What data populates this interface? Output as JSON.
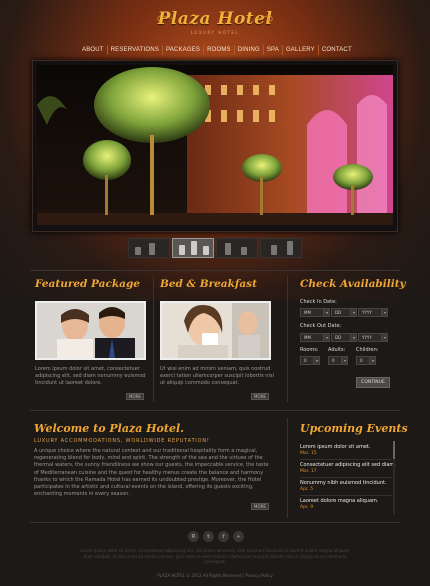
{
  "header": {
    "title": "Plaza Hotel",
    "subtitle": "LUXURY HOTEL"
  },
  "nav": {
    "items": [
      "ABOUT",
      "RESERVATIONS",
      "PACKAGES",
      "ROOMS",
      "DINING",
      "SPA",
      "GALLERY",
      "CONTACT"
    ]
  },
  "featured": {
    "title": "Featured Package",
    "text": "Lorem ipsum dolor sit amet, consectetuer adipiscing elit, sed diam nonummy euismod tincidunt ut laoreet dolore.",
    "more": "MORE"
  },
  "bnb": {
    "title": "Bed & Breakfast",
    "text": "Ut wisi enim ad minim veniam, quis nostrud exerci tation ullamcorper suscipit lobortis nisl ut aliquip commodo consequat.",
    "more": "MORE"
  },
  "availability": {
    "title": "Check Availability",
    "check_in_label": "Check In Date:",
    "check_out_label": "Check Out Date:",
    "check_in": {
      "month": "MM",
      "day": "DD",
      "year": "YYYY"
    },
    "check_out": {
      "month": "MM",
      "day": "DD",
      "year": "YYYY"
    },
    "rooms_label": "Rooms:",
    "adults_label": "Adults:",
    "children_label": "Children:",
    "rooms_value": "0",
    "adults_value": "0",
    "children_value": "0",
    "continue": "CONTINUE"
  },
  "welcome": {
    "title": "Welcome to Plaza Hotel.",
    "subtitle": "LUXURY ACCOMMODATIONS, WORLDWIDE REPUTATION!",
    "text": "A unique choice where the natural context and our traditional hospitality form a magical, regenerating blend for body, mind and spirit. The strength of the sea and the virtues of the thermal waters, the sunny friendliness we show our guests, the impeccable service, the taste of Mediterranean cuisine and the quest for healthy menus create the balance and harmony thanks to which the Ramada Hotel has earned its undoubted prestige. Moreover, the Hotel participates in the artistic and cultural events on the island, offering its guests exciting, enchanting moments in every season.",
    "more": "MORE"
  },
  "events": {
    "title": "Upcoming Events",
    "items": [
      {
        "title": "Lorem ipsum dolor sit amet.",
        "date": "Mar. 15"
      },
      {
        "title": "Consectetuer adipiscing elit sed diam.",
        "date": "Mar. 17"
      },
      {
        "title": "Nonummy nibh euismod tincidunt.",
        "date": "Apr. 5"
      },
      {
        "title": "Laoreet dolore magna aliquam.",
        "date": "Apr. 9"
      }
    ]
  },
  "footer": {
    "social": [
      "rss",
      "twitter",
      "facebook",
      "plus"
    ],
    "social_glyphs": [
      "R",
      "t",
      "f",
      "+"
    ],
    "text": "Lorem ipsum dolor sit amet, consectetuer adipiscing elit, sed diam nonummy nibh euismod tincidunt ut laoreet dolore magna aliquam erat volutpat. Ut wisi enim ad minim veniam, quis nostrud exerci tation ullamcorper suscipit lobortis nisl ut aliquip ex ea commodo consequat.",
    "copyright": "PLAZA HOTEL © 2012 All Rights Reserved  |  Privacy Policy"
  },
  "colors": {
    "accent": "#f0a632",
    "event_date": "#e28a2e",
    "background": "#1c1917"
  }
}
